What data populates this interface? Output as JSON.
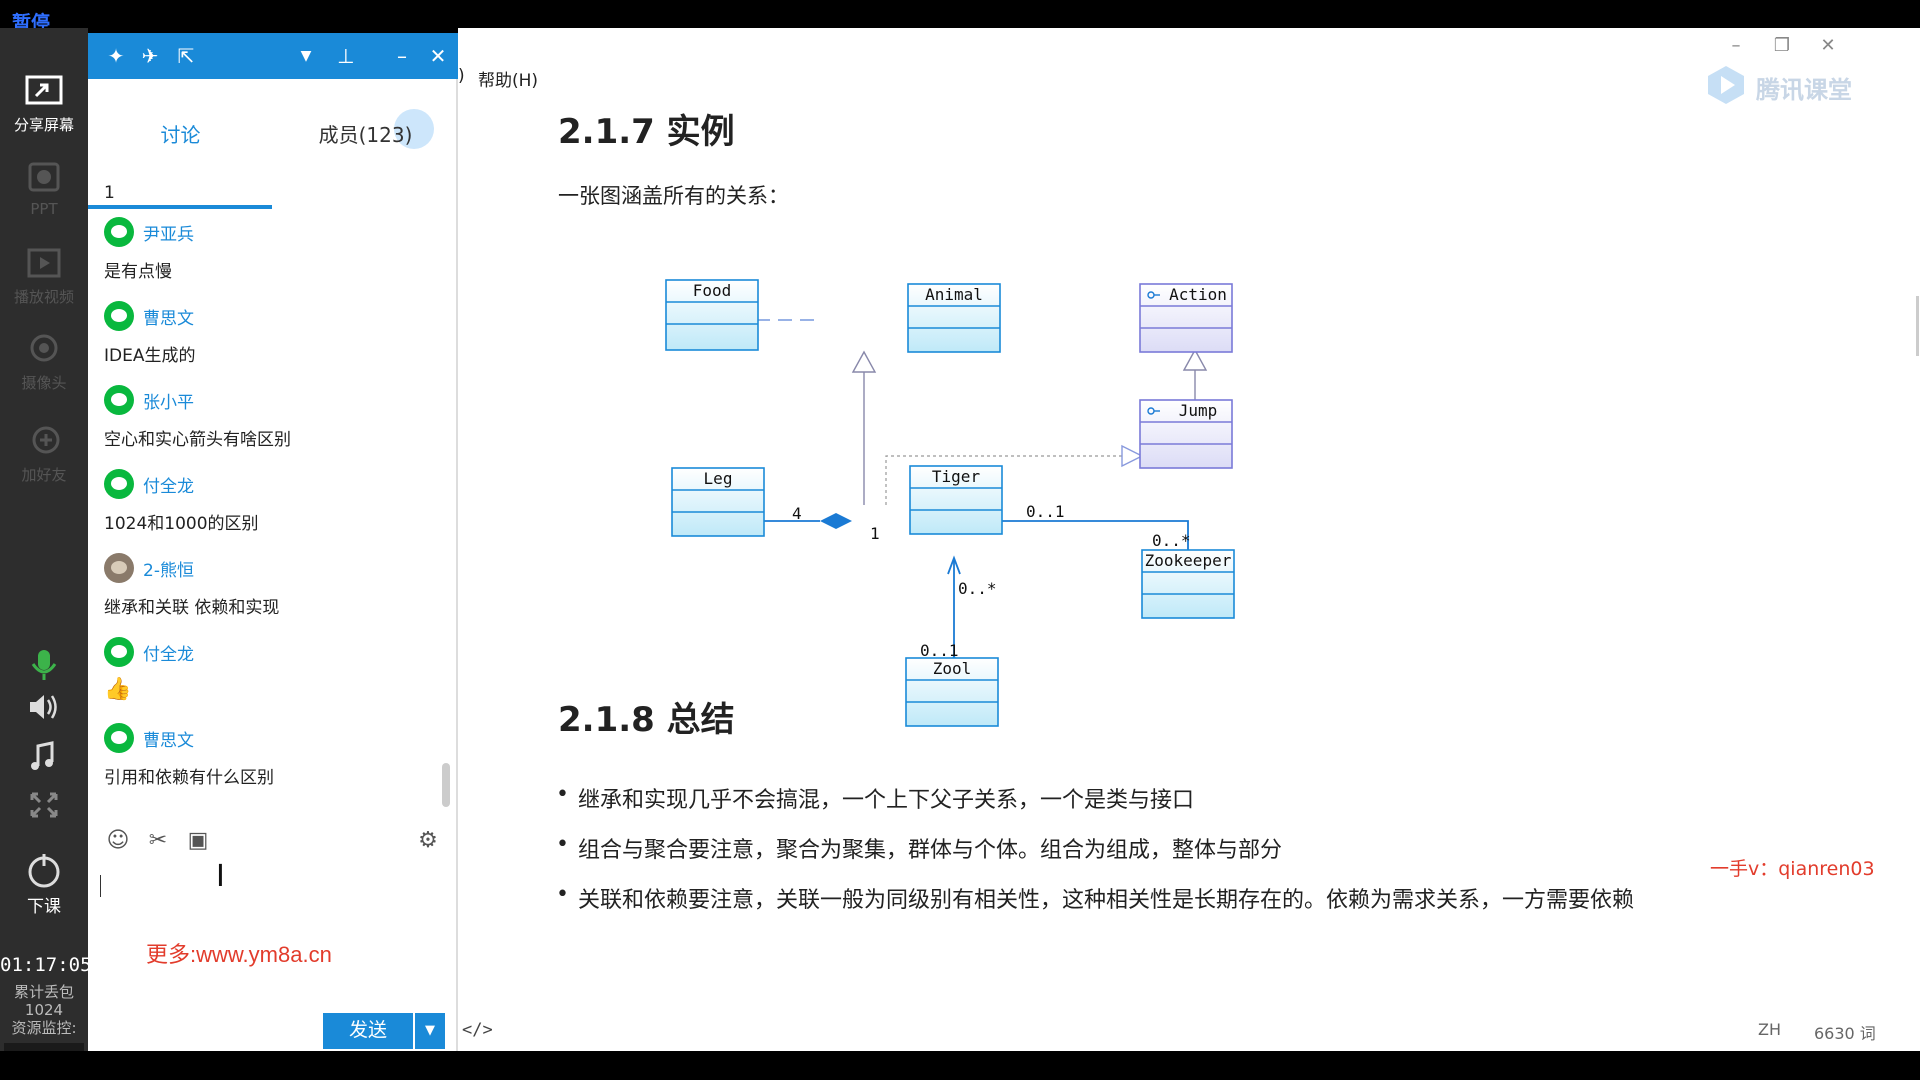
{
  "player": {
    "pause_label": "暂停"
  },
  "sidebar": {
    "items": [
      {
        "label": "分享屏幕",
        "icon": "share-screen-icon"
      },
      {
        "label": "PPT",
        "icon": "ppt-icon"
      },
      {
        "label": "播放视频",
        "icon": "play-video-icon"
      },
      {
        "label": "摄像头",
        "icon": "camera-icon"
      },
      {
        "label": "加好友",
        "icon": "add-friend-icon"
      }
    ],
    "controls": [
      "microphone-icon",
      "volume-icon",
      "music-icon",
      "fullscreen-icon"
    ],
    "end_class_label": "下课",
    "timer": "01:17:05",
    "packet_loss_label": "累计丢包",
    "packet_loss_value": "1024",
    "resource_monitor_label": "资源监控:"
  },
  "chat": {
    "tabs": [
      {
        "label": "讨论"
      },
      {
        "label": "成员(123)"
      }
    ],
    "messages": [
      {
        "sender": "",
        "text": "1",
        "avatar": "wechat"
      },
      {
        "sender": "尹亚兵",
        "text": "是有点慢",
        "avatar": "wechat"
      },
      {
        "sender": "曹思文",
        "text": "IDEA生成的",
        "avatar": "wechat"
      },
      {
        "sender": "张小平",
        "text": "空心和实心箭头有啥区别",
        "avatar": "wechat"
      },
      {
        "sender": "付全龙",
        "text": "1024和1000的区别",
        "avatar": "wechat"
      },
      {
        "sender": "2-熊恒",
        "text": "继承和关联  依赖和实现",
        "avatar": "photo"
      },
      {
        "sender": "付全龙",
        "text": "👍",
        "avatar": "wechat"
      },
      {
        "sender": "曹思文",
        "text": "引用和依赖有什么区别",
        "avatar": "wechat"
      }
    ],
    "watermark": "更多:www.ym8a.cn",
    "send_label": "发送",
    "input_value": ""
  },
  "document": {
    "menu_help": "帮助(H)",
    "menu_paren": ")",
    "brand": "腾讯课堂",
    "section1_title": "2.1.7 实例",
    "intro": "一张图涵盖所有的关系：",
    "section2_title": "2.1.8 总结",
    "contact": "一手v：qianren03",
    "bullets": [
      "继承和实现几乎不会搞混，一个上下父子关系，一个是类与接口",
      "组合与聚合要注意，聚合为聚集，群体与个体。组合为组成，整体与部分",
      "关联和依赖要注意，关联一般为同级别有相关性，这种相关性是长期存在的。依赖为需求关系，一方需要依赖"
    ],
    "status_code": "</>",
    "status_lang": "ZH",
    "status_words": "6630 词"
  },
  "uml": {
    "classes": [
      "Food",
      "Animal",
      "Action",
      "Jump",
      "Leg",
      "Tiger",
      "Zookeeper",
      "Zool"
    ],
    "multiplicities": {
      "leg_end": "4",
      "tiger_leg_end": "1",
      "tiger_keeper_end": "0..1",
      "keeper_end": "0..*",
      "tiger_zool_end": "0..*",
      "zool_end": "0..1"
    }
  }
}
